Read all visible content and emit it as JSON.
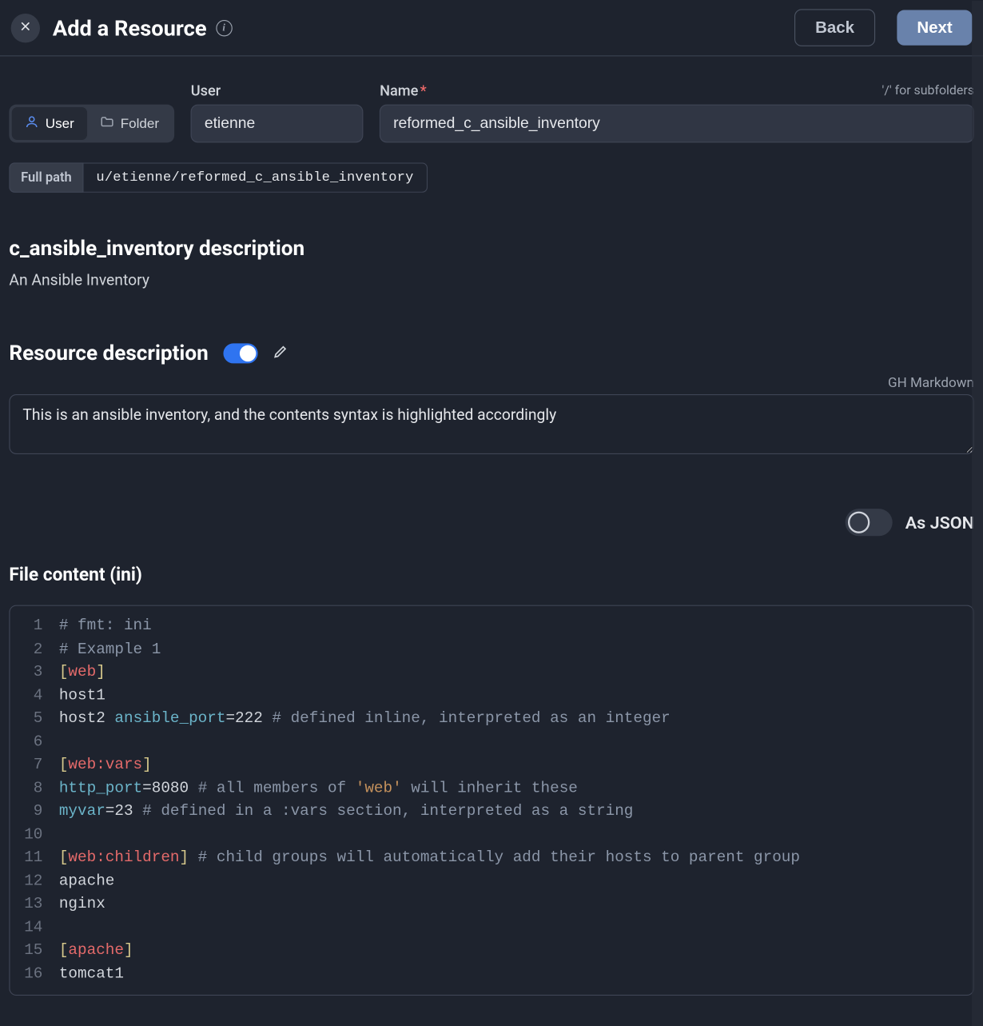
{
  "header": {
    "title": "Add a Resource",
    "back_label": "Back",
    "next_label": "Next"
  },
  "tabs": {
    "user_label": "User",
    "folder_label": "Folder"
  },
  "user_field": {
    "label": "User",
    "value": "etienne"
  },
  "name_field": {
    "label": "Name",
    "value": "reformed_c_ansible_inventory",
    "hint": "'/' for subfolders"
  },
  "full_path": {
    "label": "Full path",
    "value": "u/etienne/reformed_c_ansible_inventory"
  },
  "inventory_desc": {
    "heading": "c_ansible_inventory description",
    "text": "An Ansible Inventory"
  },
  "resource_desc": {
    "heading": "Resource description",
    "hint": "GH Markdown",
    "value": "This is an ansible inventory, and the contents syntax is highlighted accordingly"
  },
  "as_json_label": "As JSON",
  "file_heading": "File content (ini)",
  "code": [
    [
      {
        "t": "comment",
        "v": "# fmt: ini"
      }
    ],
    [
      {
        "t": "comment",
        "v": "# Example 1"
      }
    ],
    [
      {
        "t": "bracket",
        "v": "["
      },
      {
        "t": "section",
        "v": "web"
      },
      {
        "t": "bracket",
        "v": "]"
      }
    ],
    [
      {
        "t": "plain",
        "v": "host1"
      }
    ],
    [
      {
        "t": "plain",
        "v": "host2 "
      },
      {
        "t": "key",
        "v": "ansible_port"
      },
      {
        "t": "plain",
        "v": "=222 "
      },
      {
        "t": "comment",
        "v": "# defined inline, interpreted as an integer"
      }
    ],
    [],
    [
      {
        "t": "bracket",
        "v": "["
      },
      {
        "t": "section",
        "v": "web:vars"
      },
      {
        "t": "bracket",
        "v": "]"
      }
    ],
    [
      {
        "t": "key",
        "v": "http_port"
      },
      {
        "t": "plain",
        "v": "=8080 "
      },
      {
        "t": "comment",
        "v": "# all members of "
      },
      {
        "t": "str",
        "v": "'web'"
      },
      {
        "t": "comment",
        "v": " will inherit these"
      }
    ],
    [
      {
        "t": "key",
        "v": "myvar"
      },
      {
        "t": "plain",
        "v": "=23 "
      },
      {
        "t": "comment",
        "v": "# defined in a :vars section, interpreted as a string"
      }
    ],
    [],
    [
      {
        "t": "bracket",
        "v": "["
      },
      {
        "t": "section",
        "v": "web:children"
      },
      {
        "t": "bracket",
        "v": "]"
      },
      {
        "t": "plain",
        "v": " "
      },
      {
        "t": "comment",
        "v": "# child groups will automatically add their hosts to parent group"
      }
    ],
    [
      {
        "t": "plain",
        "v": "apache"
      }
    ],
    [
      {
        "t": "plain",
        "v": "nginx"
      }
    ],
    [],
    [
      {
        "t": "bracket",
        "v": "["
      },
      {
        "t": "section",
        "v": "apache"
      },
      {
        "t": "bracket",
        "v": "]"
      }
    ],
    [
      {
        "t": "plain",
        "v": "tomcat1"
      }
    ]
  ]
}
